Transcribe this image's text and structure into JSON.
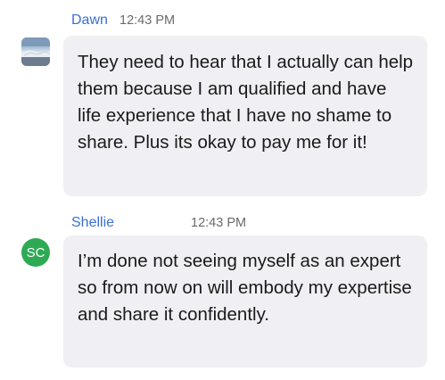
{
  "messages": [
    {
      "author": "Dawn",
      "time": "12:43 PM",
      "avatar": {
        "type": "photo",
        "icon": "profile-photo-icon"
      },
      "text": "They need to hear that I actually can help them because I am qualified and have life experience that I have no shame to share.  Plus its okay to pay me for it!"
    },
    {
      "author": "Shellie",
      "time": "12:43 PM",
      "avatar": {
        "type": "initials",
        "initials": "SC",
        "color": "#2eaa55"
      },
      "text": "I’m done not seeing myself as an expert so from now on will embody my expertise and share it confidently."
    }
  ],
  "colors": {
    "author": "#3b6fd4",
    "timestamp": "#6b6b6b",
    "bubble": "#f0f0f4",
    "text": "#1a1a1a"
  }
}
